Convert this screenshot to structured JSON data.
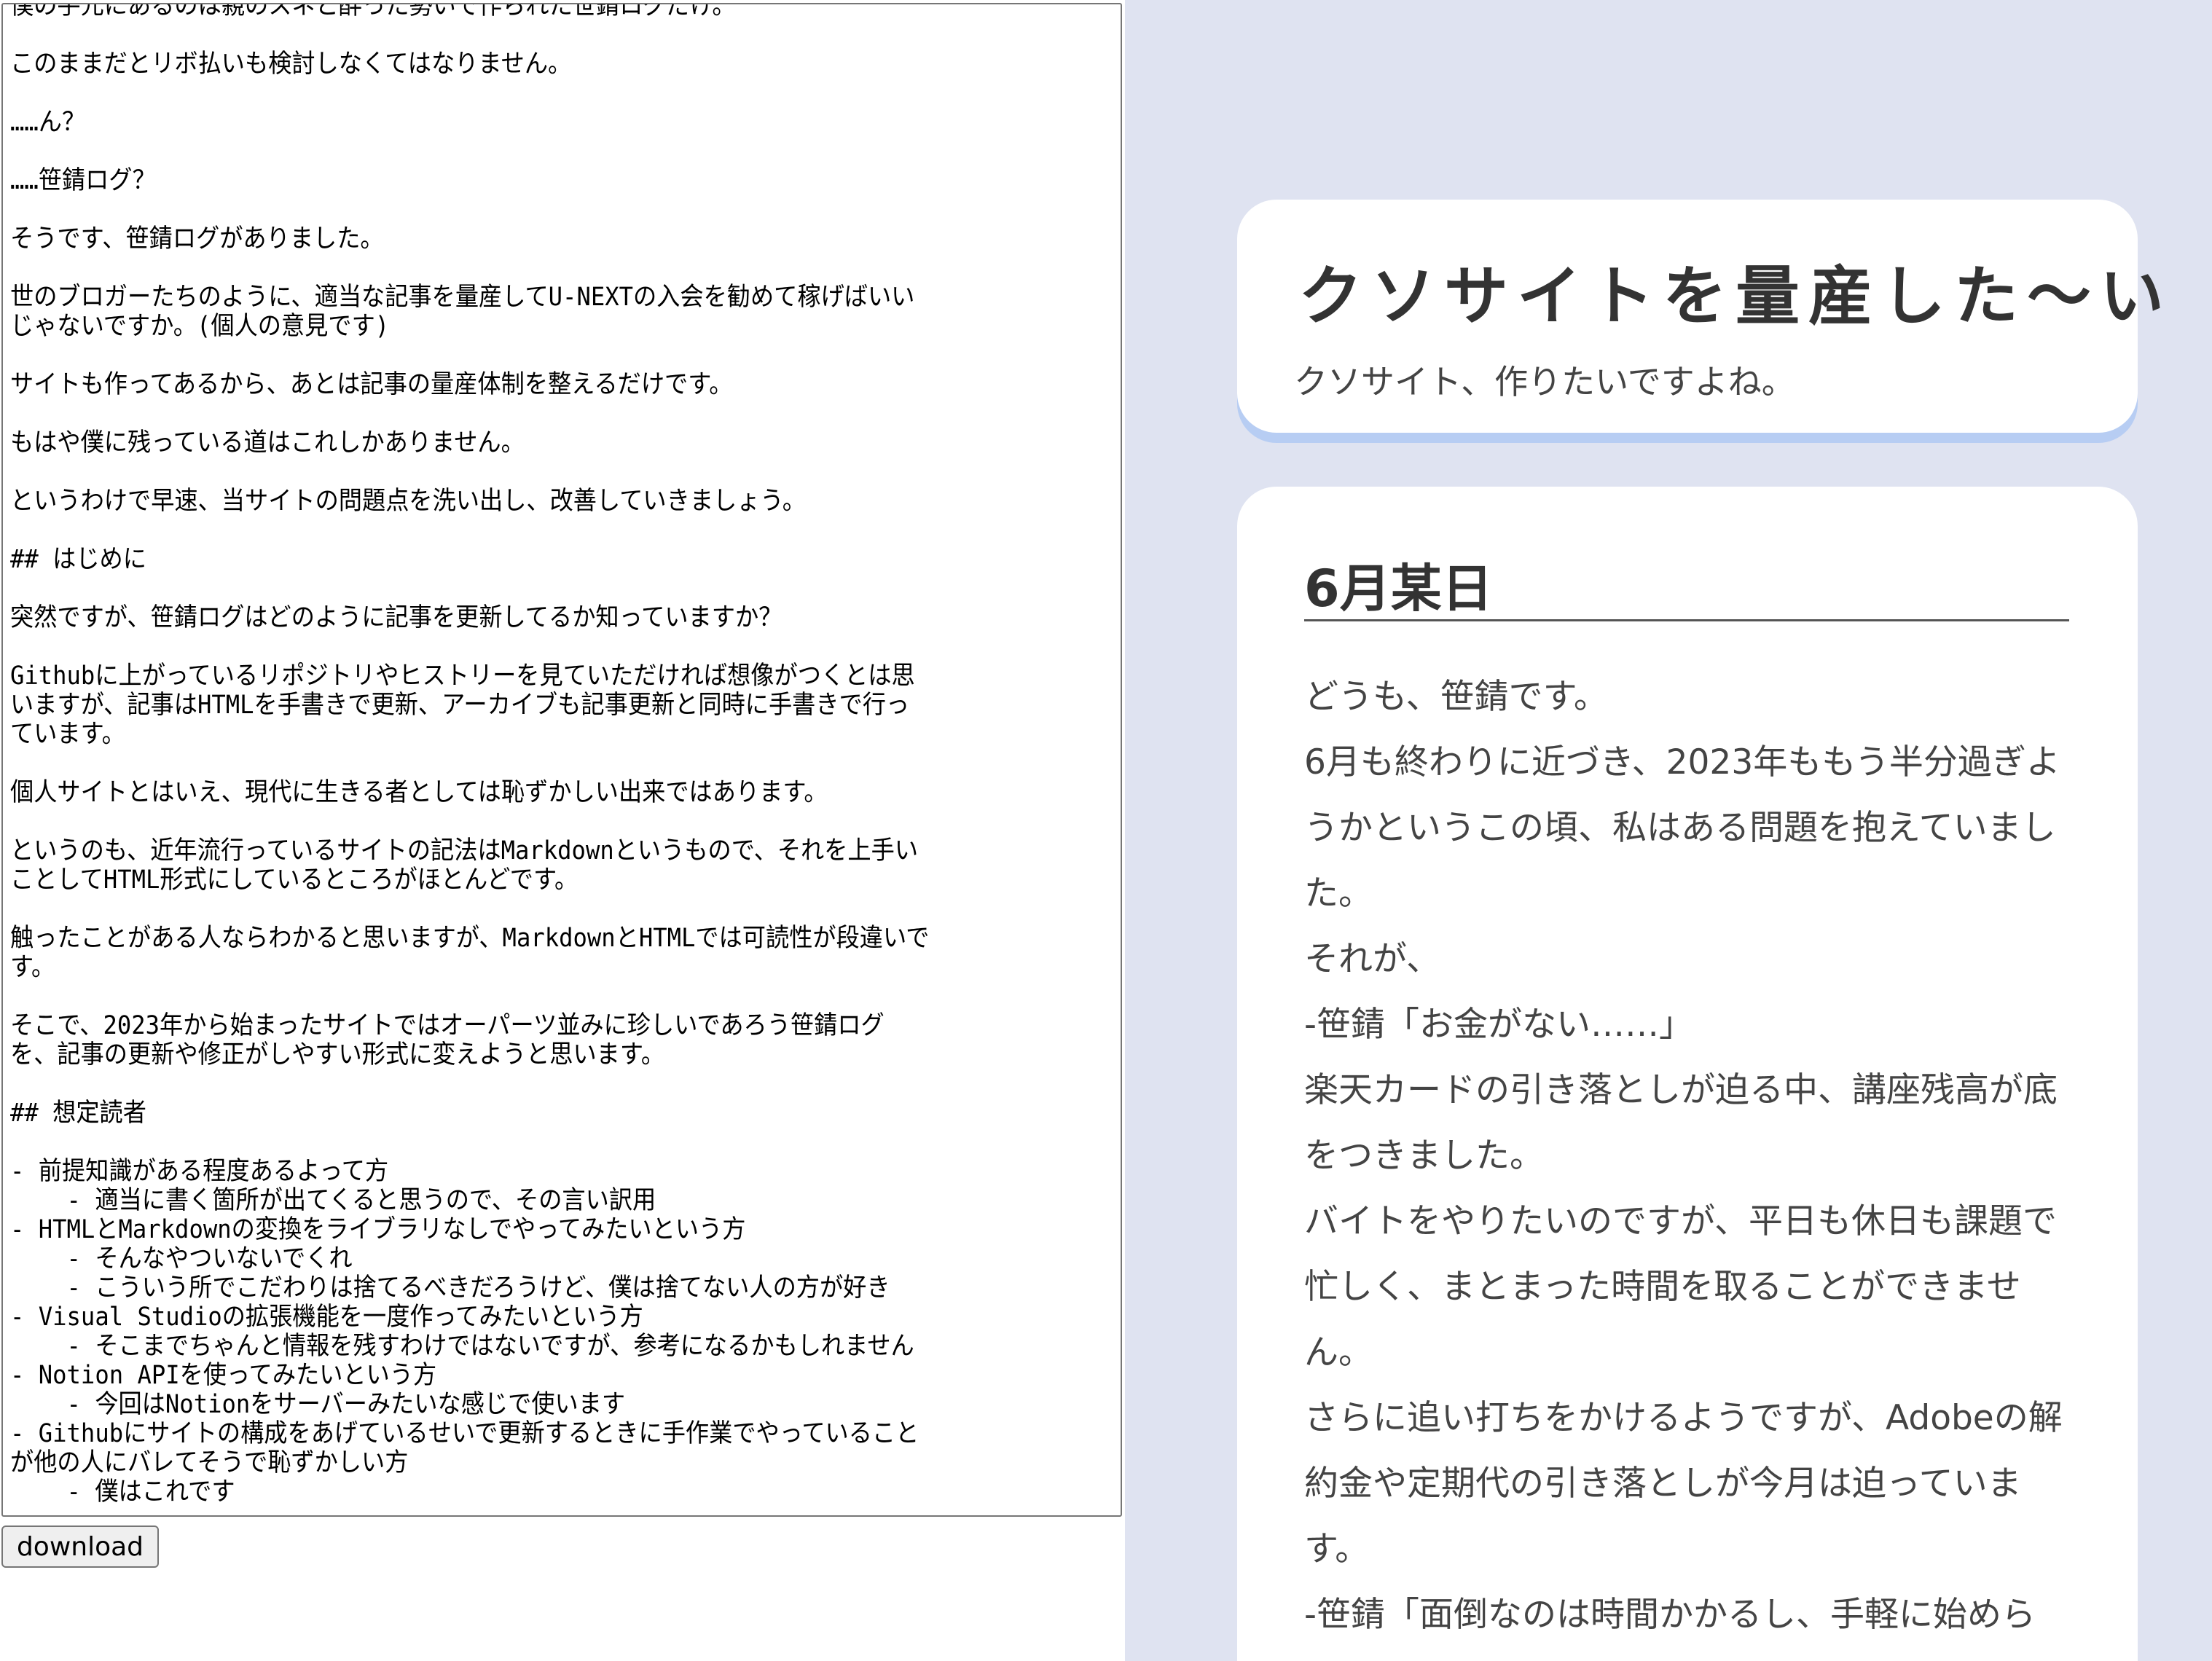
{
  "editor": {
    "lines": [
      "僕の手元にあるのは親のスネと酔った勢いで作られた笹錆ログだけ。",
      "",
      "このままだとリボ払いも検討しなくてはなりません。",
      "",
      "……ん？",
      "",
      "……笹錆ログ？",
      "",
      "そうです、笹錆ログがありました。",
      "",
      "世のブロガーたちのように、適当な記事を量産してU-NEXTの入会を勧めて稼げばいい",
      "じゃないですか。(個人の意見です)",
      "",
      "サイトも作ってあるから、あとは記事の量産体制を整えるだけです。",
      "",
      "もはや僕に残っている道はこれしかありません。",
      "",
      "というわけで早速、当サイトの問題点を洗い出し、改善していきましょう。",
      "",
      "## はじめに",
      "",
      "突然ですが、笹錆ログはどのように記事を更新してるか知っていますか？",
      "",
      "Githubに上がっているリポジトリやヒストリーを見ていただければ想像がつくとは思",
      "いますが、記事はHTMLを手書きで更新、アーカイブも記事更新と同時に手書きで行っ",
      "ています。",
      "",
      "個人サイトとはいえ、現代に生きる者としては恥ずかしい出来ではあります。",
      "",
      "というのも、近年流行っているサイトの記法はMarkdownというもので、それを上手い",
      "ことしてHTML形式にしているところがほとんどです。",
      "",
      "触ったことがある人ならわかると思いますが、MarkdownとHTMLでは可読性が段違いで",
      "す。",
      "",
      "そこで、2023年から始まったサイトではオーパーツ並みに珍しいであろう笹錆ログ",
      "を、記事の更新や修正がしやすい形式に変えようと思います。",
      "",
      "## 想定読者",
      "",
      "- 前提知識がある程度あるよって方",
      "    - 適当に書く箇所が出てくると思うので、その言い訳用",
      "- HTMLとMarkdownの変換をライブラリなしでやってみたいという方",
      "    - そんなやついないでくれ",
      "    - こういう所でこだわりは捨てるべきだろうけど、僕は捨てない人の方が好き",
      "- Visual Studioの拡張機能を一度作ってみたいという方",
      "    - そこまでちゃんと情報を残すわけではないですが、参考になるかもしれません",
      "- Notion APIを使ってみたいという方",
      "    - 今回はNotionをサーバーみたいな感じで使います",
      "- Githubにサイトの構成をあげているせいで更新するときに手作業でやっていること",
      "が他の人にバレてそうで恥ずかしい方",
      "    - 僕はこれです"
    ],
    "download_label": "download"
  },
  "preview": {
    "site_title": "クソサイトを量産した～い",
    "site_subtitle": "クソサイト、作りたいですよね。",
    "article_title": "6月某日",
    "paragraphs": [
      "どうも、笹錆です。",
      "6月も終わりに近づき、2023年ももう半分過ぎようかというこの頃、私はある問題を抱えていました。",
      "それが、",
      "-笹錆「お金がない……」",
      "楽天カードの引き落としが迫る中、講座残高が底をつきました。",
      "バイトをやりたいのですが、平日も休日も課題で忙しく、まとまった時間を取ることができません。",
      "さらに追い打ちをかけるようですが、Adobeの解約金や定期代の引き落としが今月は迫っています。",
      "-笹錆「面倒なのは時間かかるし、手軽に始めら"
    ]
  },
  "colors": {
    "preview_background": "#dfe3f1",
    "header_shadow": "#b7cdf3",
    "text": "#333333"
  }
}
